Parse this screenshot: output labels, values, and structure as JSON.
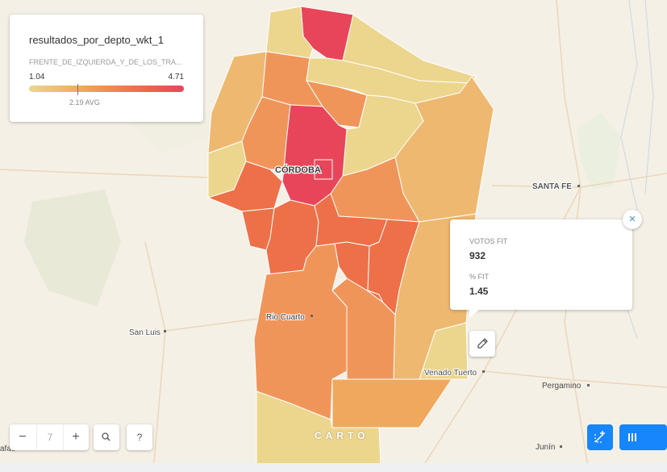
{
  "legend": {
    "title": "resultados_por_depto_wkt_1",
    "field": "FRENTE_DE_IZQUIERDA_Y_DE_LOS_TRA...",
    "min": "1.04",
    "max": "4.71",
    "avg": "2.19 AVG",
    "avg_value": 2.19
  },
  "popup": {
    "field1_label": "VOTOS FIT",
    "field1_value": "932",
    "field2_label": "% FIT",
    "field2_value": "1.45",
    "close_icon": "close-icon",
    "edit_icon": "pencil-icon"
  },
  "map_labels": {
    "cordoba": "CÓRDOBA",
    "santa_fe": "SANTA FE",
    "rio_cuarto": "Rio Cuarto",
    "san_luis": "San Luis",
    "venado_tuerto": "Venado Tuerto",
    "pergamino": "Pergamino",
    "junin": "Junín",
    "fragment_left": "afae"
  },
  "controls": {
    "zoom_level": "7",
    "zoom_out": "−",
    "zoom_in": "+",
    "search_icon": "search-icon",
    "help": "?",
    "draw_icon": "draw-icon",
    "bars_icon": "widgets-icon",
    "logo": "CARTO"
  },
  "colors": {
    "low": "#ecd68e",
    "mid_low": "#eeb870",
    "mid": "#f0955a",
    "mid_high": "#ee7048",
    "high": "#e9455a",
    "accent": "#1785fb"
  }
}
